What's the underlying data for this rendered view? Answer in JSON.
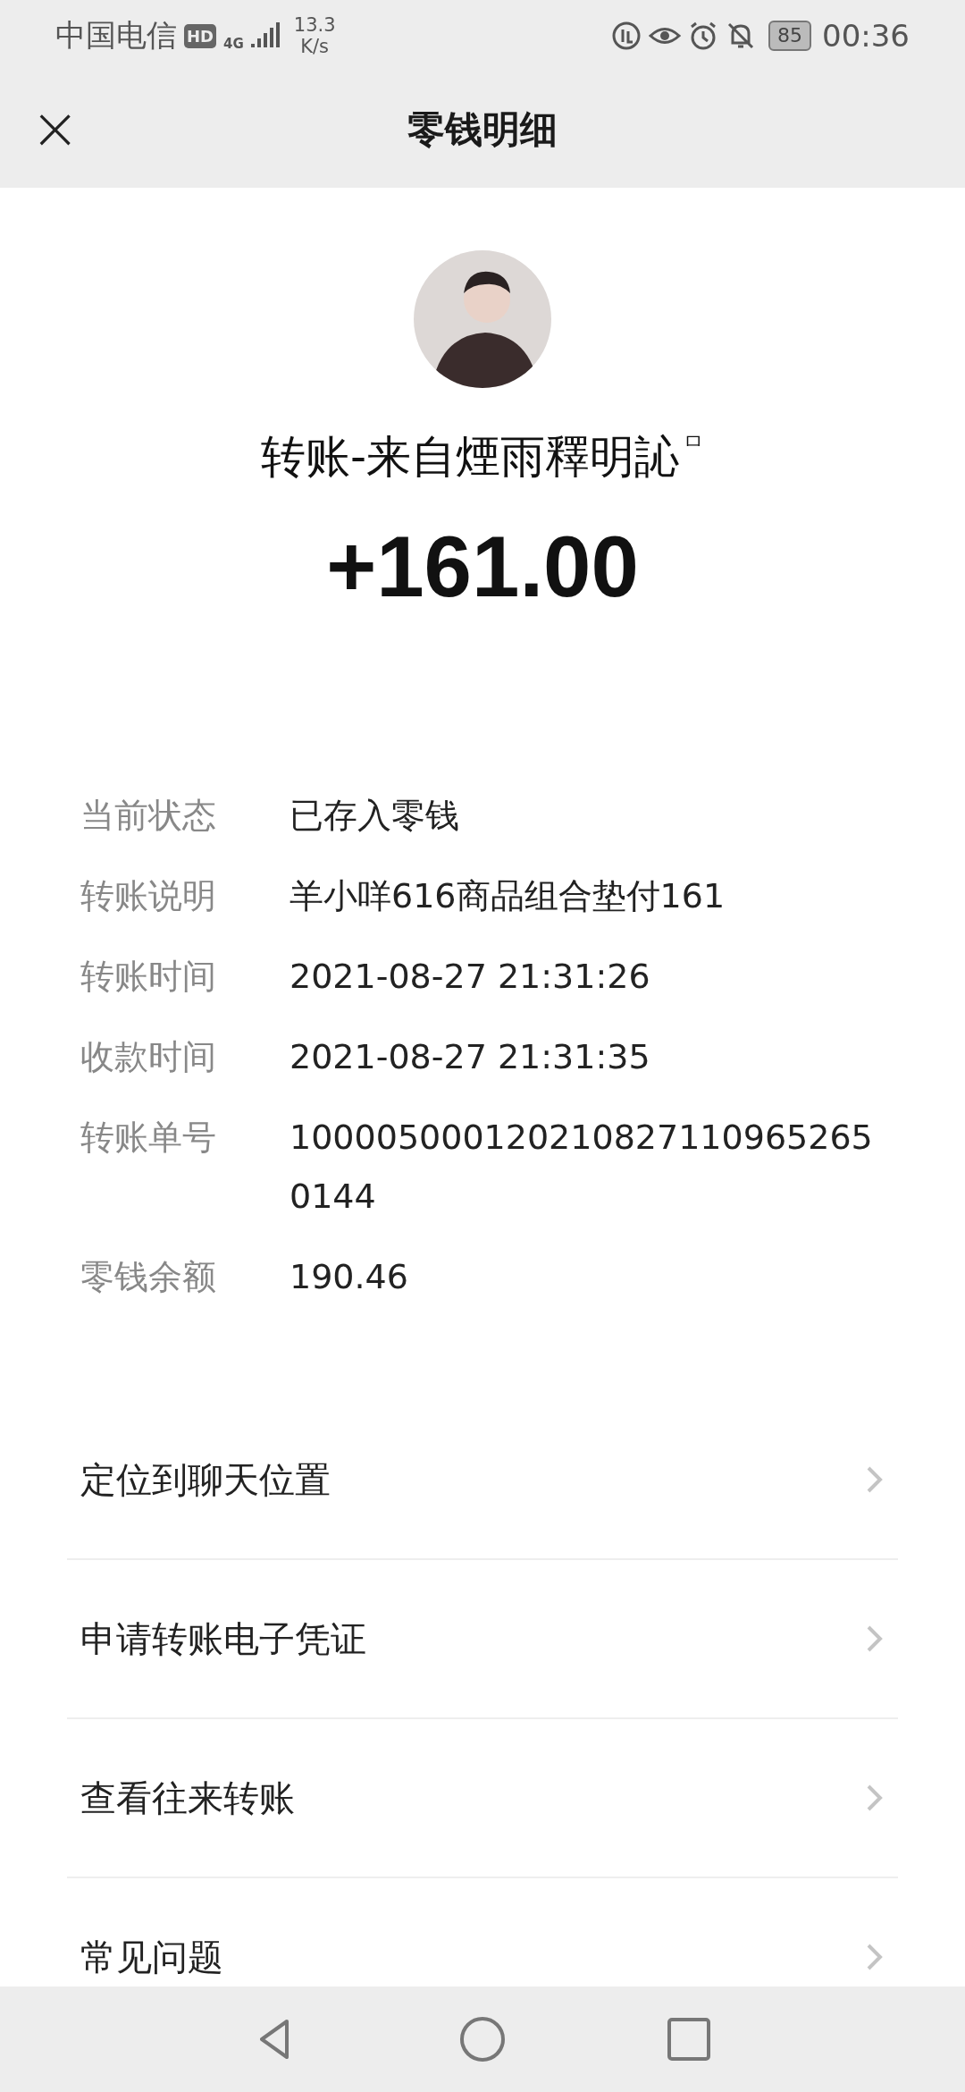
{
  "status_bar": {
    "carrier": "中国电信",
    "hd_badge": "HD",
    "network": "4G",
    "speed_value": "13.3",
    "speed_unit": "K/s",
    "battery": "85",
    "time": "00:36"
  },
  "header": {
    "close": "×",
    "title": "零钱明细"
  },
  "transfer": {
    "title": "转账-来自煙雨釋明訫",
    "title_mark": "ㅁ",
    "amount": "+161.00"
  },
  "details": [
    {
      "label": "当前状态",
      "value": "已存入零钱"
    },
    {
      "label": "转账说明",
      "value": "羊小咩616商品组合垫付161"
    },
    {
      "label": "转账时间",
      "value": "2021-08-27 21:31:26"
    },
    {
      "label": "收款时间",
      "value": "2021-08-27 21:31:35"
    },
    {
      "label": "转账单号",
      "value": "1000050001202108271109652650144"
    },
    {
      "label": "零钱余额",
      "value": "190.46"
    }
  ],
  "menu": [
    {
      "label": "定位到聊天位置"
    },
    {
      "label": "申请转账电子凭证"
    },
    {
      "label": "查看往来转账"
    },
    {
      "label": "常见问题"
    }
  ]
}
